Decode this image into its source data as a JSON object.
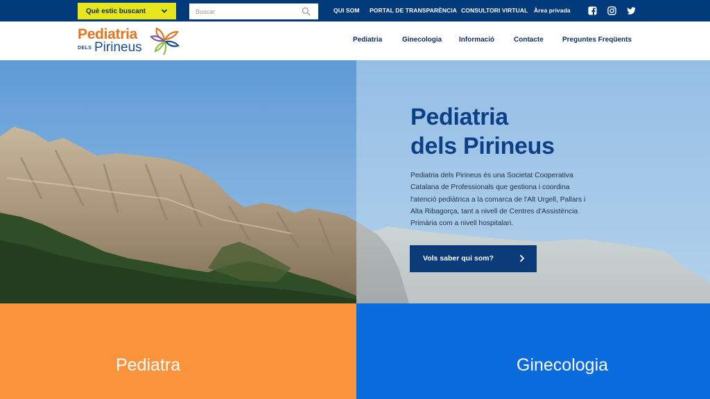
{
  "topbar": {
    "whats_label": "Què estic buscant",
    "search_placeholder": "Buscar",
    "links": [
      "QUI SOM",
      "PORTAL DE TRANSPARÈNCIA",
      "CONSULTORI VIRTUAL",
      "Àrea privada"
    ],
    "social": [
      "facebook-icon",
      "instagram-icon",
      "twitter-icon"
    ]
  },
  "logo": {
    "line1": "Pediatria",
    "line2_small": "DELS",
    "line2": "Pirineus"
  },
  "nav": [
    "Pediatria",
    "Ginecologia",
    "Informació",
    "Contacte",
    "Preguntes Freqüents"
  ],
  "hero": {
    "title_line1": "Pediatria",
    "title_line2": "dels Pirineus",
    "text": "Pediatria dels Pirineus és una Societat Cooperativa Catalana de Professionals que gestiona i coordina l'atenció pediàtrica a la comarca de l'Alt Urgell, Pallars i Alta Ribagorça, tant a nivell de Centres d'Assistència Primària com a nivell hospitalari.",
    "cta_label": "Vols saber qui som?"
  },
  "tiles": {
    "pediatra": "Pediatra",
    "ginecologia": "Ginecologia"
  },
  "colors": {
    "topbar": "#003a7a",
    "whats_bg": "#e6e61a",
    "brand_orange": "#e5731f",
    "brand_blue": "#1a4a8c",
    "title_blue": "#0b3f86",
    "cta_bg": "#0b3a78",
    "tile_orange": "#fb933d",
    "tile_blue": "#0a6bdc"
  }
}
